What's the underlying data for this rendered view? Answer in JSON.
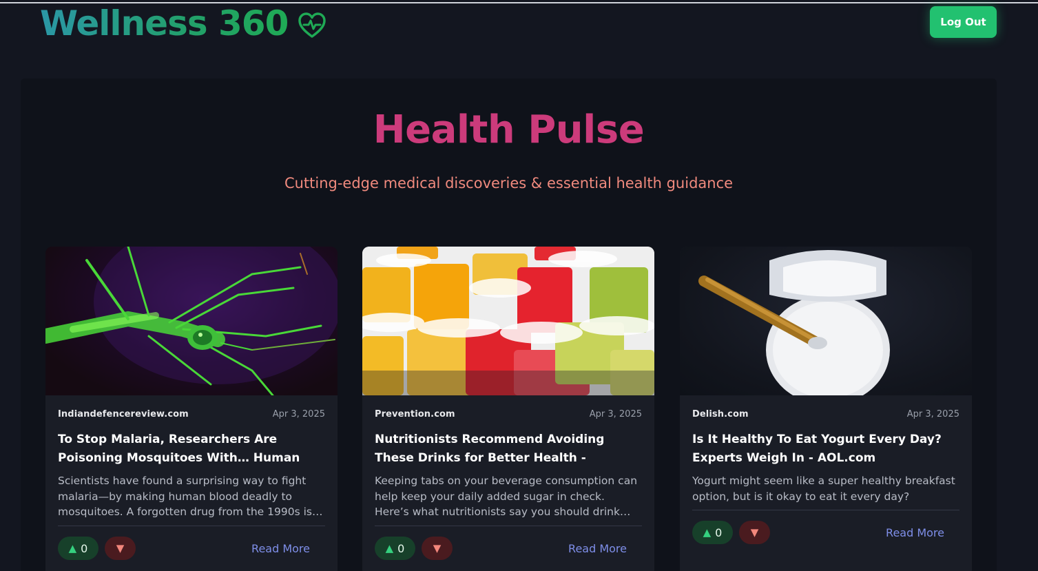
{
  "header": {
    "brand_title": "Wellness 360",
    "logout_label": "Log Out"
  },
  "hero": {
    "title": "Health Pulse",
    "subtitle": "Cutting-edge medical discoveries & essential health guidance"
  },
  "articles": [
    {
      "source": "Indiandefencereview.com",
      "date": "Apr 3, 2025",
      "title": "To Stop Malaria, Researchers Are Poisoning Mosquitoes With… Human Bloo…",
      "description": "Scientists have found a surprising way to fight malaria—by making human blood deadly to mosquitoes. A forgotten drug from the 1990s is…",
      "upvotes": "0",
      "read_more": "Read More"
    },
    {
      "source": "Prevention.com",
      "date": "Apr 3, 2025",
      "title": "Nutritionists Recommend Avoiding These Drinks for Better Health - AOL.com",
      "description": "Keeping tabs on your beverage consumption can help keep your daily added sugar in check. Here’s what nutritionists say you should drink…",
      "upvotes": "0",
      "read_more": "Read More"
    },
    {
      "source": "Delish.com",
      "date": "Apr 3, 2025",
      "title": "Is It Healthy To Eat Yogurt Every Day? Experts Weigh In - AOL.com",
      "description": "Yogurt might seem like a super healthy breakfast option, but is it okay to eat it every day?",
      "upvotes": "0",
      "read_more": "Read More"
    }
  ],
  "icons": {
    "brand": "heart-pulse-icon",
    "upvote": "triangle-up-icon",
    "downvote": "triangle-down-icon"
  },
  "colors": {
    "accent_green": "#22c170",
    "hero_title": "#cc3b7b",
    "hero_subtitle": "#f08a7e",
    "link": "#7e8ee8"
  }
}
